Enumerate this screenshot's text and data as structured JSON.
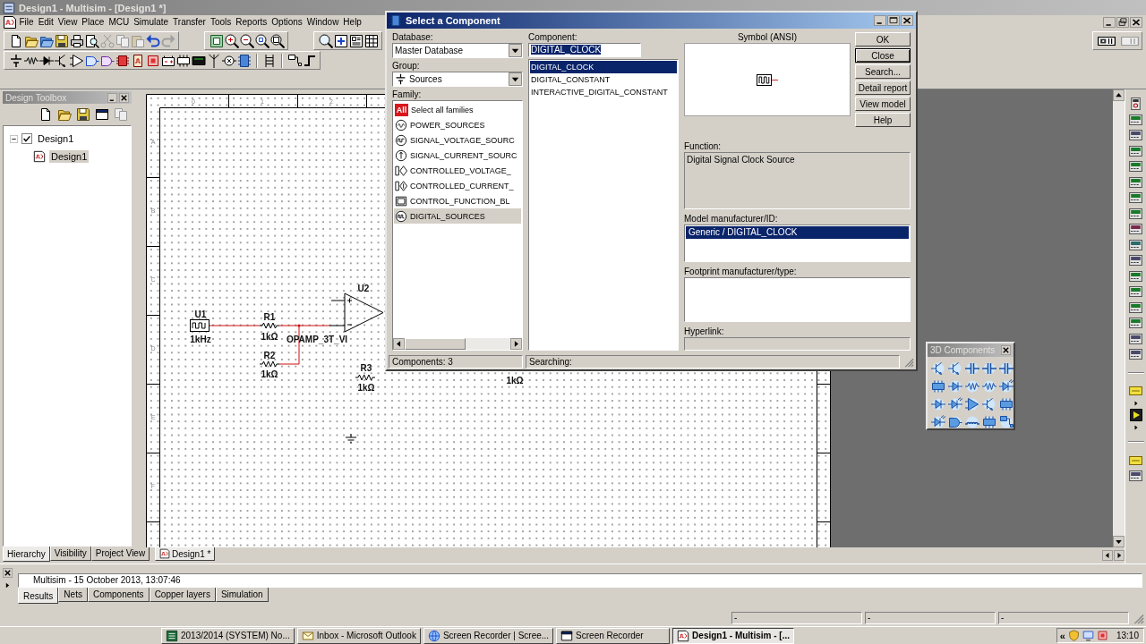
{
  "window": {
    "title": "Design1 - Multisim - [Design1 *]",
    "active": false
  },
  "menu": [
    "File",
    "Edit",
    "View",
    "Place",
    "MCU",
    "Simulate",
    "Transfer",
    "Tools",
    "Reports",
    "Options",
    "Window",
    "Help"
  ],
  "design_toolbox": {
    "title": "Design Toolbox",
    "active": false,
    "tree": [
      {
        "kind": "design",
        "label": "Design1",
        "checked": true,
        "expanded": true,
        "selected": false,
        "children": [
          {
            "kind": "sheet",
            "label": "Design1",
            "selected": true
          }
        ]
      }
    ],
    "tabs": [
      {
        "label": "Hierarchy",
        "selected": true
      },
      {
        "label": "Visibility",
        "selected": false
      },
      {
        "label": "Project View",
        "selected": false
      }
    ]
  },
  "schematic": {
    "column_labels": [
      "0",
      "1",
      "2"
    ],
    "row_labels": [
      "A",
      "B",
      "C",
      "D",
      "E",
      "F"
    ],
    "parts": [
      {
        "kind": "clock",
        "ref": "U1",
        "value": "1kHz"
      },
      {
        "kind": "resistor",
        "ref": "R1",
        "value": "1kΩ"
      },
      {
        "kind": "resistor",
        "ref": "R2",
        "value": "1kΩ"
      },
      {
        "kind": "opamp",
        "ref": "U2",
        "value": "OPAMP_3T_VI"
      },
      {
        "kind": "resistor",
        "ref": "R3",
        "value": "1kΩ"
      },
      {
        "kind": "ground"
      },
      {
        "kind": "value_label",
        "value": "1kΩ"
      }
    ],
    "tabs": [
      {
        "label": "Design1 *",
        "selected": true
      }
    ]
  },
  "dialog": {
    "title": "Select a Component",
    "active": true,
    "database": {
      "label": "Database:",
      "value": "Master Database"
    },
    "group": {
      "label": "Group:",
      "value": "Sources"
    },
    "family": {
      "label": "Family:",
      "items": [
        {
          "kind": "all",
          "badge": "All",
          "label": "Select all families",
          "selected": false
        },
        {
          "kind": "power",
          "label": "POWER_SOURCES",
          "selected": false
        },
        {
          "kind": "signal_voltage",
          "label": "SIGNAL_VOLTAGE_SOURC",
          "selected": false
        },
        {
          "kind": "signal_current",
          "label": "SIGNAL_CURRENT_SOURC",
          "selected": false
        },
        {
          "kind": "controlled_voltage",
          "label": "CONTROLLED_VOLTAGE_",
          "selected": false
        },
        {
          "kind": "controlled_current",
          "label": "CONTROLLED_CURRENT_",
          "selected": false
        },
        {
          "kind": "control_function",
          "label": "CONTROL_FUNCTION_BL",
          "selected": false
        },
        {
          "kind": "digital",
          "label": "DIGITAL_SOURCES",
          "selected": true
        }
      ]
    },
    "component": {
      "label": "Component:",
      "value": "DIGITAL_CLOCK",
      "text_selected": true,
      "items": [
        {
          "label": "DIGITAL_CLOCK",
          "selected": true
        },
        {
          "label": "DIGITAL_CONSTANT",
          "selected": false
        },
        {
          "label": "INTERACTIVE_DIGITAL_CONSTANT",
          "selected": false
        }
      ]
    },
    "symbol": {
      "label": "Symbol (ANSI)"
    },
    "buttons": [
      {
        "label": "OK",
        "default": false
      },
      {
        "label": "Close",
        "default": true
      },
      {
        "label": "Search...",
        "default": false
      },
      {
        "label": "Detail report",
        "default": false
      },
      {
        "label": "View model",
        "default": false
      },
      {
        "label": "Help",
        "default": false
      }
    ],
    "function": {
      "label": "Function:",
      "value": "Digital Signal Clock Source"
    },
    "model": {
      "label": "Model manufacturer/ID:",
      "items": [
        {
          "label": "Generic / DIGITAL_CLOCK",
          "selected": true
        }
      ]
    },
    "footprint": {
      "label": "Footprint manufacturer/type:"
    },
    "hyperlink": {
      "label": "Hyperlink:"
    },
    "status": [
      "Components: 3",
      "Searching:"
    ]
  },
  "components_3d": {
    "title": "3D Components",
    "active": false
  },
  "results": {
    "log": "Multisim - 15 October 2013, 13:07:46",
    "tabs": [
      {
        "label": "Results",
        "selected": true
      },
      {
        "label": "Nets",
        "selected": false
      },
      {
        "label": "Components",
        "selected": false
      },
      {
        "label": "Copper layers",
        "selected": false
      },
      {
        "label": "Simulation",
        "selected": false
      }
    ]
  },
  "status_bar": [
    "-",
    "-",
    "-"
  ],
  "taskbar": {
    "items": [
      {
        "label": "2013/2014 (SYSTEM) No...",
        "selected": false
      },
      {
        "label": "Inbox - Microsoft Outlook",
        "selected": false
      },
      {
        "label": "Screen Recorder | Scree...",
        "selected": false
      },
      {
        "label": "Screen Recorder",
        "selected": false
      },
      {
        "label": "Design1 - Multisim - [...",
        "selected": true
      }
    ],
    "tray": {
      "expander": "«",
      "clock": "13:10"
    }
  }
}
